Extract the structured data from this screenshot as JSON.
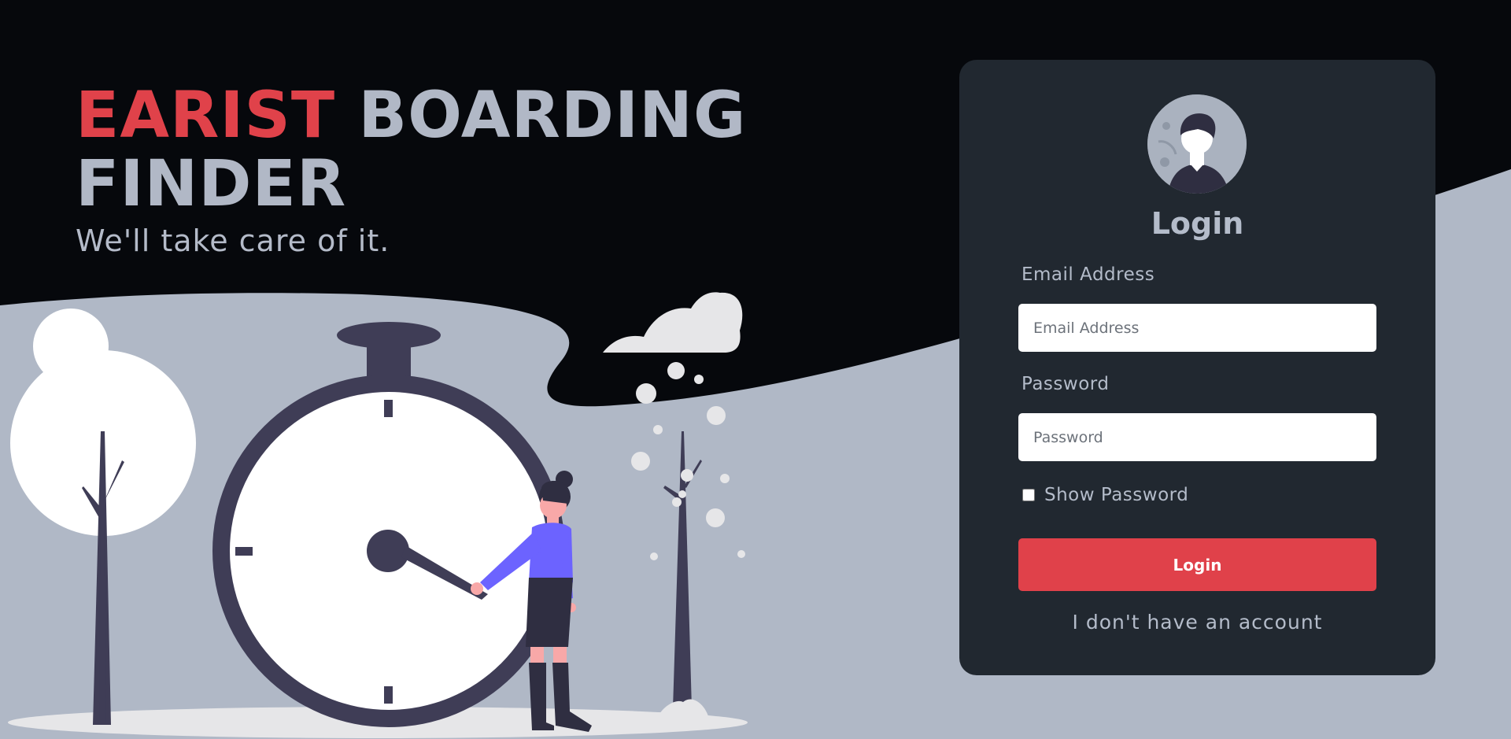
{
  "hero": {
    "title_accent": "EARIST",
    "title_rest": "BOARDING",
    "title_line2": "FINDER",
    "subtitle": "We'll take care of it."
  },
  "login_card": {
    "title": "Login",
    "email_label": "Email Address",
    "email_placeholder": "Email Address",
    "email_value": "",
    "password_label": "Password",
    "password_placeholder": "Password",
    "password_value": "",
    "show_password_label": "Show Password",
    "show_password_checked": false,
    "login_button": "Login",
    "no_account_link": "I don't have an account"
  },
  "icons": {
    "avatar": "user-avatar-icon",
    "illustration": "stopwatch-woman-illustration"
  },
  "colors": {
    "accent": "#e0424a",
    "background_dark": "#06080c",
    "ground": "#b0b8c6",
    "card": "#212830"
  }
}
